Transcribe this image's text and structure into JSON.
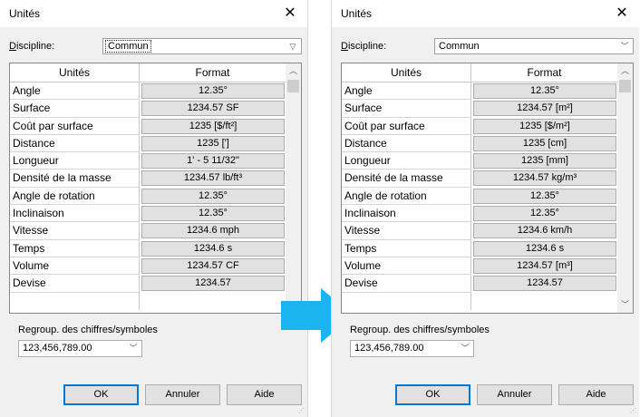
{
  "left": {
    "title": "Unités",
    "close": "✕",
    "discipline_label_first": "D",
    "discipline_label_rest": "iscipline:",
    "discipline_value": "Commun",
    "grid": {
      "col_units": "Unités",
      "col_format": "Format",
      "rows": [
        {
          "name": "Angle",
          "format": "12.35°"
        },
        {
          "name": "Surface",
          "format": "1234.57 SF"
        },
        {
          "name": "Coût par surface",
          "format": "1235 [$/ft²]"
        },
        {
          "name": "Distance",
          "format": "1235 [']"
        },
        {
          "name": "Longueur",
          "format": "1' - 5 11/32\""
        },
        {
          "name": "Densité de la masse",
          "format": "1234.57 lb/ft³"
        },
        {
          "name": "Angle de rotation",
          "format": "12.35°"
        },
        {
          "name": "Inclinaison",
          "format": "12.35°"
        },
        {
          "name": "Vitesse",
          "format": "1234.6 mph"
        },
        {
          "name": "Temps",
          "format": "1234.6 s"
        },
        {
          "name": "Volume",
          "format": "1234.57 CF"
        },
        {
          "name": "Devise",
          "format": "1234.57"
        }
      ]
    },
    "grouping_label_first": "Re",
    "grouping_label_u": "g",
    "grouping_label_rest": "roup. des chiffres/symboles",
    "grouping_value": "123,456,789.00",
    "ok": "OK",
    "cancel": "Annuler",
    "help": "Aide"
  },
  "right": {
    "title": "Unités",
    "close": "✕",
    "discipline_label_first": "D",
    "discipline_label_rest": "iscipline:",
    "discipline_value": "Commun",
    "grid": {
      "col_units": "Unités",
      "col_format": "Format",
      "rows": [
        {
          "name": "Angle",
          "format": "12.35°"
        },
        {
          "name": "Surface",
          "format": "1234.57 [m²]"
        },
        {
          "name": "Coût par surface",
          "format": "1235 [$/m²]"
        },
        {
          "name": "Distance",
          "format": "1235 [cm]"
        },
        {
          "name": "Longueur",
          "format": "1235 [mm]"
        },
        {
          "name": "Densité de la masse",
          "format": "1234.57 kg/m³"
        },
        {
          "name": "Angle de rotation",
          "format": "12.35°"
        },
        {
          "name": "Inclinaison",
          "format": "12.35°"
        },
        {
          "name": "Vitesse",
          "format": "1234.6 km/h"
        },
        {
          "name": "Temps",
          "format": "1234.6 s"
        },
        {
          "name": "Volume",
          "format": "1234.57 [m³]"
        },
        {
          "name": "Devise",
          "format": "1234.57"
        }
      ]
    },
    "grouping_label_first": "Re",
    "grouping_label_u": "g",
    "grouping_label_rest": "roup. des chiffres/symboles",
    "grouping_value": "123,456,789.00",
    "ok": "OK",
    "cancel": "Annuler",
    "help": "Aide"
  },
  "colors": {
    "arrow": "#1ab4f0",
    "ok_border": "#0078d7"
  },
  "icons": {
    "arrow": "right-arrow-icon",
    "close": "close-icon",
    "dropdown": "chevron-down-icon"
  }
}
